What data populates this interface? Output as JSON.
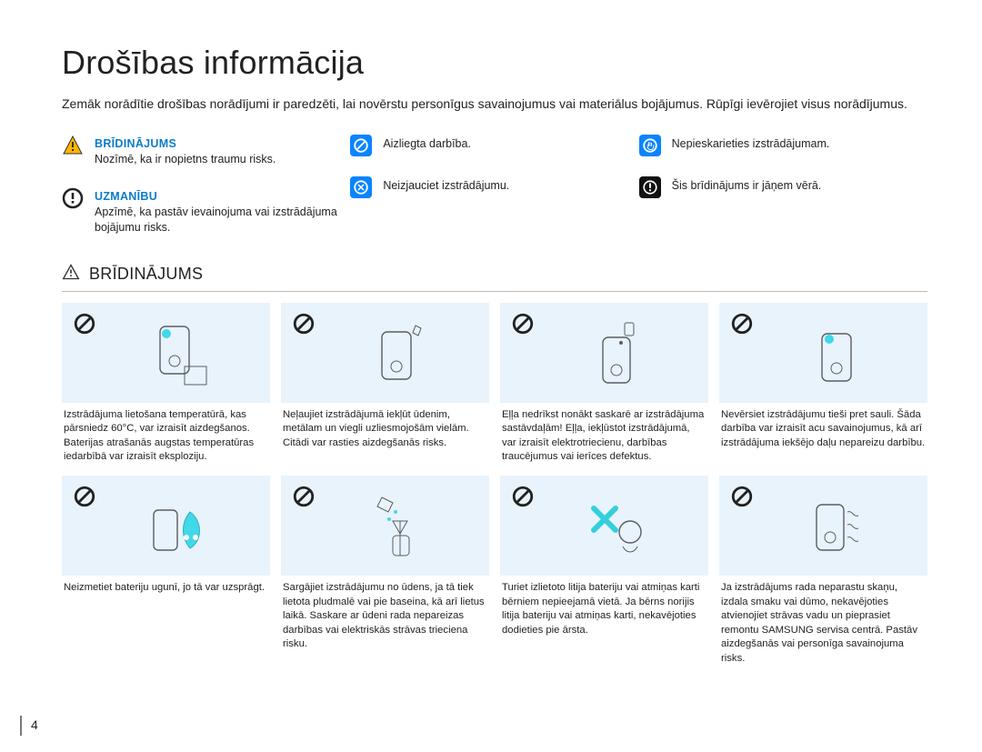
{
  "page_number": "4",
  "title": "Drošības informācija",
  "intro": "Zemāk norādītie drošības norādījumi ir paredzēti, lai novērstu personīgus savainojumus vai materiālus bojājumus. Rūpīgi ievērojiet visus norādījumus.",
  "legend": {
    "col1": {
      "warn_title": "BRĪDINĀJUMS",
      "warn_text": "Nozīmē, ka ir nopietns traumu risks.",
      "caut_title": "UZMANĪBU",
      "caut_text": "Apzīmē, ka pastāv ievainojuma vai izstrādājuma bojājumu risks."
    },
    "col2": {
      "a": "Aizliegta darbība.",
      "b": "Neizjauciet izstrādājumu."
    },
    "col3": {
      "a": "Nepieskarieties izstrādājumam.",
      "b": "Šis brīdinājums ir jāņem vērā."
    }
  },
  "section_title": "BRĪDINĀJUMS",
  "row1": {
    "c1": "Izstrādājuma lietošana temperatūrā, kas pārsniedz 60°C, var izraisīt aizdegšanos. Baterijas atrašanās augstas temperatūras iedarbībā var izraisīt eksploziju.",
    "c2": "Neļaujiet izstrādājumā iekļūt ūdenim, metālam un viegli uzliesmojošām vielām. Citādi var rasties aizdegšanās risks.",
    "c3": "Eļļa nedrīkst nonākt saskarē ar izstrādājuma sastāvdaļām! Eļļa, iekļūstot izstrādājumā, var izraisīt elektrotriecienu, darbības traucējumus vai ierīces defektus.",
    "c4": "Nevērsiet izstrādājumu tieši pret sauli. Šāda darbība var izraisīt acu savainojumus, kā arī izstrādājuma iekšējo daļu nepareizu darbību."
  },
  "row2": {
    "c1": "Neizmetiet bateriju ugunī, jo tā var uzsprāgt.",
    "c2": "Sargājiet izstrādājumu no ūdens, ja tā tiek lietota pludmalē vai pie baseina, kā arī lietus laikā. Saskare ar ūdeni rada nepareizas darbības vai elektriskās strāvas trieciena risku.",
    "c3": "Turiet izlietoto litija bateriju vai atmiņas karti bērniem nepieejamā vietā. Ja bērns norijis litija bateriju vai atmiņas karti, nekavējoties dodieties pie ārsta.",
    "c4": "Ja izstrādājums rada neparastu skaņu, izdala smaku vai dūmo, nekavējoties atvienojiet strāvas vadu un pieprasiet remontu SAMSUNG servisa centrā. Pastāv aizdegšanās vai personīga savainojuma risks."
  }
}
